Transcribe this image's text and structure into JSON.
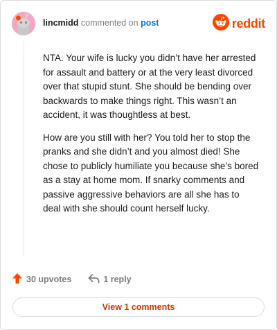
{
  "header": {
    "username": "lincmidd",
    "action_text": "commented on",
    "post_link": "post",
    "brand": "reddit",
    "avatar_icon": "snoo-avatar-icon",
    "brand_icon": "reddit-logo-icon"
  },
  "comment": {
    "paragraphs": [
      "NTA. Your wife is lucky you didn’t have her arrested for assault and battery or at the very least divorced over that stupid stunt. She should be bending over backwards to make things right. This wasn’t an accident, it was thoughtless at best.",
      "How are you still with her? You told her to stop the pranks and she didn’t and you almost died! She chose to publicly humiliate you because she’s bored as a stay at home mom. If snarky comments and passive aggressive behaviors are all she has to deal with she should count herself lucky."
    ]
  },
  "actions": {
    "upvotes": "30 upvotes",
    "replies": "1 reply",
    "upvote_icon": "upvote-arrow-icon",
    "reply_icon": "reply-arrow-icon"
  },
  "footer": {
    "view_comments": "View 1 comments"
  },
  "colors": {
    "brand": "#ff4500",
    "link": "#0079d3",
    "muted": "#7c7c7c",
    "avatar": "#f3a7c2",
    "view_button_text": "#cc3700"
  }
}
